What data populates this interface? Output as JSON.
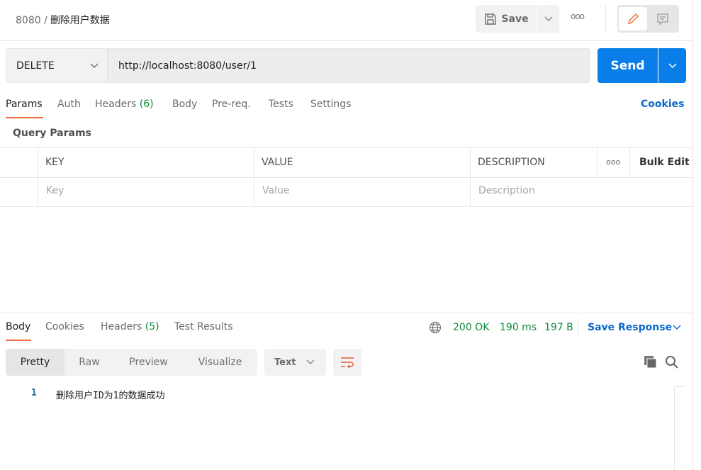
{
  "header": {
    "collection": "8080",
    "separator": "/",
    "request_name": "删除用户数据",
    "save_label": "Save",
    "more_label": "ooo"
  },
  "request": {
    "method": "DELETE",
    "url": "http://localhost:8080/user/1",
    "send_label": "Send"
  },
  "request_tabs": [
    {
      "label": "Params"
    },
    {
      "label": "Auth"
    },
    {
      "label": "Headers",
      "count": "(6)"
    },
    {
      "label": "Body"
    },
    {
      "label": "Pre-req."
    },
    {
      "label": "Tests"
    },
    {
      "label": "Settings"
    }
  ],
  "cookies_label": "Cookies",
  "params": {
    "title": "Query Params",
    "columns": [
      "KEY",
      "VALUE",
      "DESCRIPTION"
    ],
    "more": "ooo",
    "bulk_edit": "Bulk Edit",
    "placeholders": {
      "key": "Key",
      "value": "Value",
      "description": "Description"
    }
  },
  "response": {
    "tabs": [
      {
        "label": "Body"
      },
      {
        "label": "Cookies"
      },
      {
        "label": "Headers",
        "count": "(5)"
      },
      {
        "label": "Test Results"
      }
    ],
    "status": "200 OK",
    "time": "190 ms",
    "size": "197 B",
    "save_response": "Save Response",
    "views": [
      "Pretty",
      "Raw",
      "Preview",
      "Visualize"
    ],
    "format": "Text",
    "lines": [
      {
        "no": "1",
        "text": "删除用户ID为1的数据成功"
      }
    ]
  },
  "colors": {
    "accent": "#f26b3a",
    "send": "#0a7ee8",
    "link": "#0b68c9",
    "success": "#0c8a3a"
  }
}
